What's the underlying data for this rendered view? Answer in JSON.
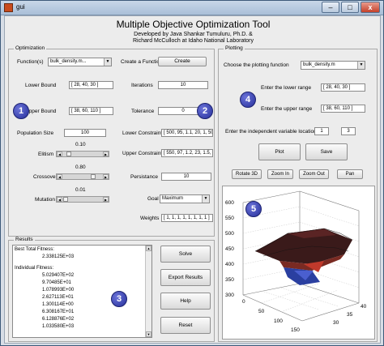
{
  "window": {
    "title": "gui",
    "min_label": "–",
    "max_label": "□",
    "close_label": "x"
  },
  "header": {
    "title": "Multiple Objective Optimization Tool",
    "line1": "Developed by Java Shankar Tumuluru, Ph.D. &",
    "line2": "Richard McCulloch at Idaho National Laboratory"
  },
  "optimization": {
    "panel_label": "Optimization",
    "functions_label": "Function(s)",
    "functions_value": "bulk_density.m...",
    "create_function_label": "Create a Function",
    "create_button": "Create",
    "lower_bound_label": "Lower Bound",
    "lower_bound_value": "[ 28, 40, 30 ]",
    "iterations_label": "Iterations",
    "iterations_value": "10",
    "upper_bound_label": "Upper Bound",
    "upper_bound_value": "[ 38, 60, 110 ]",
    "tolerance_label": "Tolerance",
    "tolerance_value": "0",
    "population_label": "Population Size",
    "population_value": "100",
    "lower_constraint_label": "Lower Constraint",
    "lower_constraint_value": "[ 500, 95, 1.1, 20, 1, 50, 6",
    "elitism_label": "Elitism",
    "elitism_value": "0.10",
    "elitism_fraction": 0.1,
    "upper_constraint_label": "Upper Constraint",
    "upper_constraint_value": "[ 550, 97, 1.2, 23, 1.5, 70",
    "crossover_label": "Crossover",
    "crossover_value": "0.80",
    "crossover_fraction": 0.8,
    "persistance_label": "Persistance",
    "persistance_value": "10",
    "mutation_label": "Mutation",
    "mutation_value": "0.01",
    "mutation_fraction": 0.01,
    "goal_label": "Goal",
    "goal_value": "Maximum",
    "weights_label": "Weights",
    "weights_value": "[ 1, 1, 1, 1, 1, 1, 1, 1 ]"
  },
  "results": {
    "panel_label": "Results",
    "best_label": "Best Total Fitness:",
    "best_value": "2.338125E+03",
    "individual_label": "Individual Fitness:",
    "individual_values": [
      "5.029407E+02",
      "9.70485E+01",
      "1.078993E+00",
      "2.627113E+01",
      "1.300114E+00",
      "6.308167E+01",
      "6.128876E+02",
      "1.033580E+03"
    ],
    "solve_button": "Solve",
    "export_button": "Export Results",
    "help_button": "Help",
    "reset_button": "Reset"
  },
  "plotting": {
    "panel_label": "Plotting",
    "choose_label": "Choose the plotting function",
    "choose_value": "bulk_density.m",
    "lower_range_label": "Enter the lower range",
    "lower_range_value": "[ 28, 40, 30 ]",
    "upper_range_label": "Enter the upper range",
    "upper_range_value": "[ 38, 60, 110 ]",
    "indep_label": "Enter the independent variable locations",
    "indep_value_1": "1",
    "indep_value_2": "3",
    "plot_button": "Plot",
    "save_button": "Save",
    "rotate_button": "Rotate 3D",
    "zoom_in_button": "Zoom In",
    "zoom_out_button": "Zoom Out",
    "pan_button": "Pan"
  },
  "chart": {
    "z_ticks": [
      "600",
      "550",
      "500",
      "450",
      "400",
      "350",
      "300"
    ],
    "x_ticks": [
      "0",
      "50",
      "100",
      "150"
    ],
    "y_ticks": [
      "30",
      "35",
      "40"
    ]
  },
  "badges": [
    "1",
    "2",
    "3",
    "4",
    "5"
  ],
  "colors": {
    "badge": "#2b35a8",
    "surface_dark": "#3a1a1a",
    "surface_red": "#c0392b",
    "surface_blue": "#2a3fa0"
  }
}
